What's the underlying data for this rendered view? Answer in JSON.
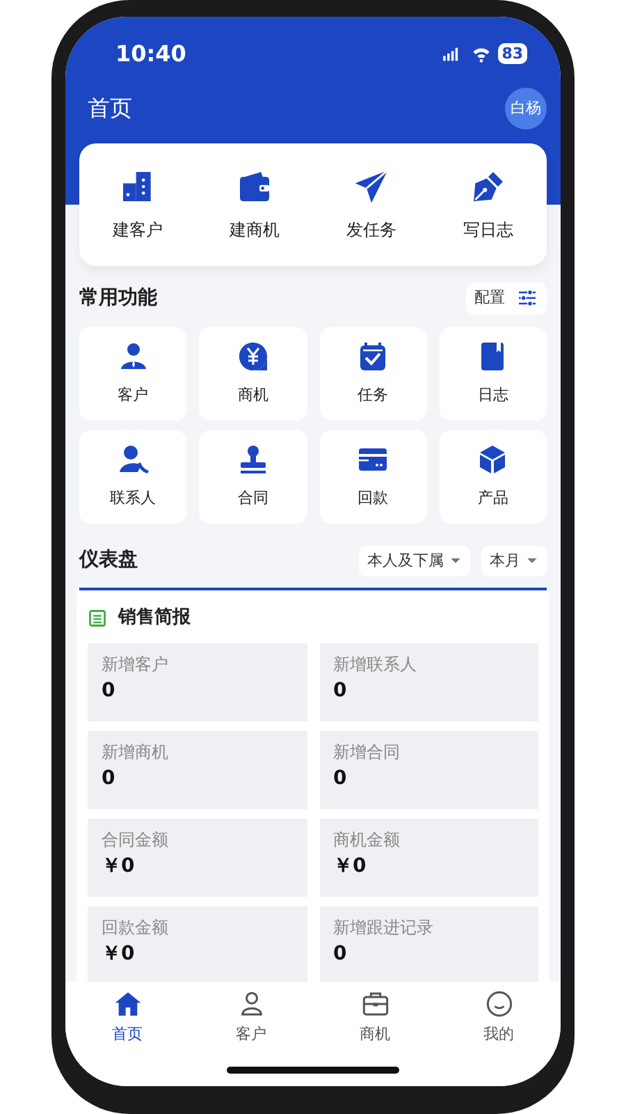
{
  "status_bar": {
    "time": "10:40",
    "battery": "83"
  },
  "header": {
    "title": "首页",
    "avatar": "白杨"
  },
  "quick_actions": [
    {
      "label": "建客户"
    },
    {
      "label": "建商机"
    },
    {
      "label": "发任务"
    },
    {
      "label": "写日志"
    }
  ],
  "common_functions": {
    "title": "常用功能",
    "config": "配置",
    "items": [
      {
        "label": "客户"
      },
      {
        "label": "商机"
      },
      {
        "label": "任务"
      },
      {
        "label": "日志"
      },
      {
        "label": "联系人"
      },
      {
        "label": "合同"
      },
      {
        "label": "回款"
      },
      {
        "label": "产品"
      }
    ]
  },
  "dashboard": {
    "title": "仪表盘",
    "filters": [
      "本人及下属",
      "本月"
    ],
    "report_title": "销售简报",
    "stats": [
      {
        "label": "新增客户",
        "value": "0"
      },
      {
        "label": "新增联系人",
        "value": "0"
      },
      {
        "label": "新增商机",
        "value": "0"
      },
      {
        "label": "新增合同",
        "value": "0"
      },
      {
        "label": "合同金额",
        "value": "￥0"
      },
      {
        "label": "商机金额",
        "value": "￥0"
      },
      {
        "label": "回款金额",
        "value": "￥0"
      },
      {
        "label": "新增跟进记录",
        "value": "0"
      }
    ]
  },
  "tab_bar": [
    {
      "label": "首页",
      "selected": true
    },
    {
      "label": "客户",
      "selected": false
    },
    {
      "label": "商机",
      "selected": false
    },
    {
      "label": "我的",
      "selected": false
    }
  ]
}
